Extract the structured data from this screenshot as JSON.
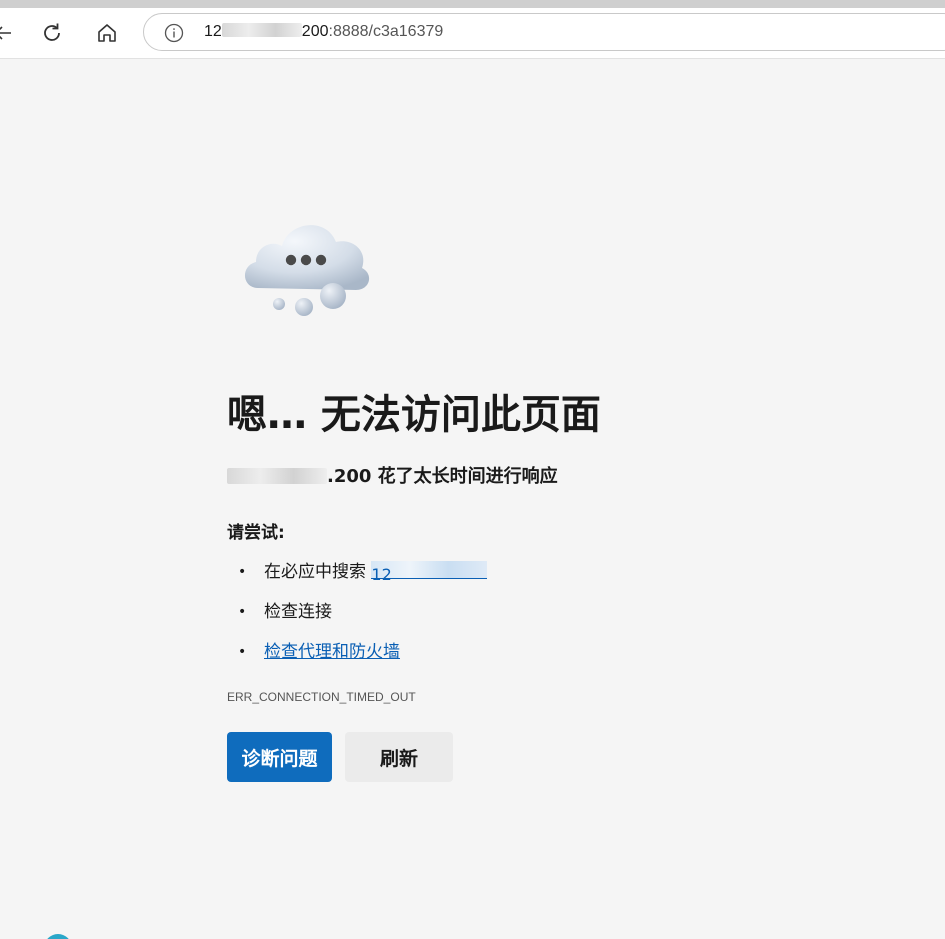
{
  "browser": {
    "url_host_start": "12",
    "url_host_end": "200",
    "url_rest": ":8888/c3a16379"
  },
  "error_page": {
    "title": "嗯… 无法访问此页面",
    "subtitle_suffix": ".200 花了太长时间进行响应",
    "try_label": "请尝试:",
    "suggestions": [
      {
        "text": "在必应中搜索 ",
        "link_text": "12"
      },
      {
        "text": "检查连接"
      },
      {
        "link_text": "检查代理和防火墙"
      }
    ],
    "error_code": "ERR_CONNECTION_TIMED_OUT",
    "buttons": {
      "diagnose": "诊断问题",
      "refresh": "刷新"
    }
  },
  "colors": {
    "primary_button": "#0f6cbd",
    "link": "#0a5fb4",
    "page_background": "#f5f5f5"
  },
  "icons": [
    "back-icon",
    "reload-icon",
    "home-icon",
    "info-icon",
    "cloud-error-icon"
  ]
}
